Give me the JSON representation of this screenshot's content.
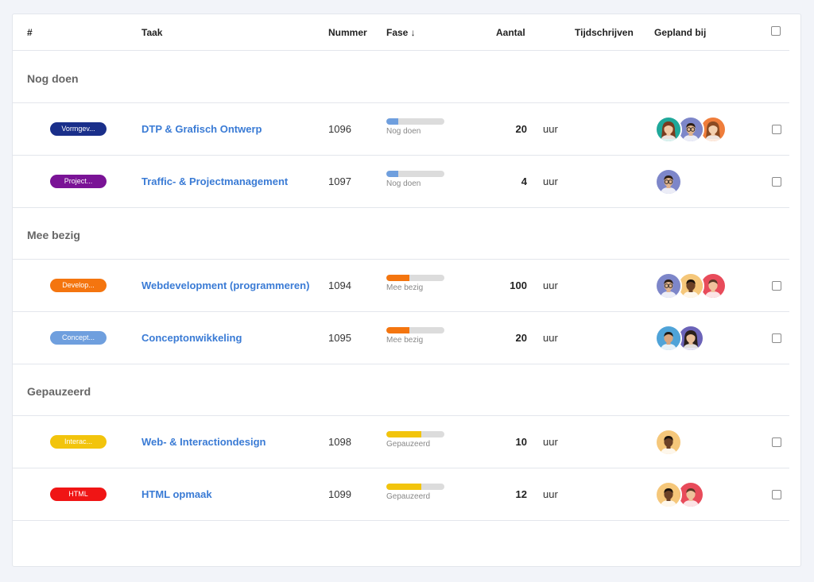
{
  "columns": {
    "hash": "#",
    "task": "Taak",
    "number": "Nummer",
    "phase": "Fase ↓",
    "amount": "Aantal",
    "time": "Tijdschrijven",
    "planned": "Gepland bij"
  },
  "groups": [
    {
      "title": "Nog doen"
    },
    {
      "title": "Mee bezig"
    },
    {
      "title": "Gepauzeerd"
    }
  ],
  "tasks": [
    {
      "badge": "Vormgev...",
      "badge_color": "#1a2f8a",
      "name": "DTP & Grafisch Ontwerp",
      "number": "1096",
      "phase": "Nog doen",
      "phase_color": "#6f9fde",
      "progress": 0.2,
      "amount": "20",
      "unit": "uur",
      "avatars": [
        "woman-teal",
        "man-glasses",
        "woman-orange"
      ]
    },
    {
      "badge": "Project...",
      "badge_color": "#7a1396",
      "name": "Traffic- & Projectmanagement",
      "number": "1097",
      "phase": "Nog doen",
      "phase_color": "#6f9fde",
      "progress": 0.2,
      "amount": "4",
      "unit": "uur",
      "avatars": [
        "man-glasses"
      ]
    },
    {
      "badge": "Develop...",
      "badge_color": "#f4750f",
      "name": "Webdevelopment (programmeren)",
      "number": "1094",
      "phase": "Mee bezig",
      "phase_color": "#f4750f",
      "progress": 0.4,
      "amount": "100",
      "unit": "uur",
      "avatars": [
        "man-glasses",
        "man-dark",
        "man-red"
      ]
    },
    {
      "badge": "Concept...",
      "badge_color": "#6f9fde",
      "name": "Conceptonwikkeling",
      "number": "1095",
      "phase": "Mee bezig",
      "phase_color": "#f4750f",
      "progress": 0.4,
      "amount": "20",
      "unit": "uur",
      "avatars": [
        "man-blue",
        "woman-purple"
      ]
    },
    {
      "badge": "Interac...",
      "badge_color": "#f2c40c",
      "name": "Web- & Interactiondesign",
      "number": "1098",
      "phase": "Gepauzeerd",
      "phase_color": "#f2c40c",
      "progress": 0.6,
      "amount": "10",
      "unit": "uur",
      "avatars": [
        "man-dark"
      ]
    },
    {
      "badge": "HTML",
      "badge_color": "#f01515",
      "name": "HTML opmaak",
      "number": "1099",
      "phase": "Gepauzeerd",
      "phase_color": "#f2c40c",
      "progress": 0.6,
      "amount": "12",
      "unit": "uur",
      "avatars": [
        "man-dark",
        "man-red"
      ]
    }
  ]
}
